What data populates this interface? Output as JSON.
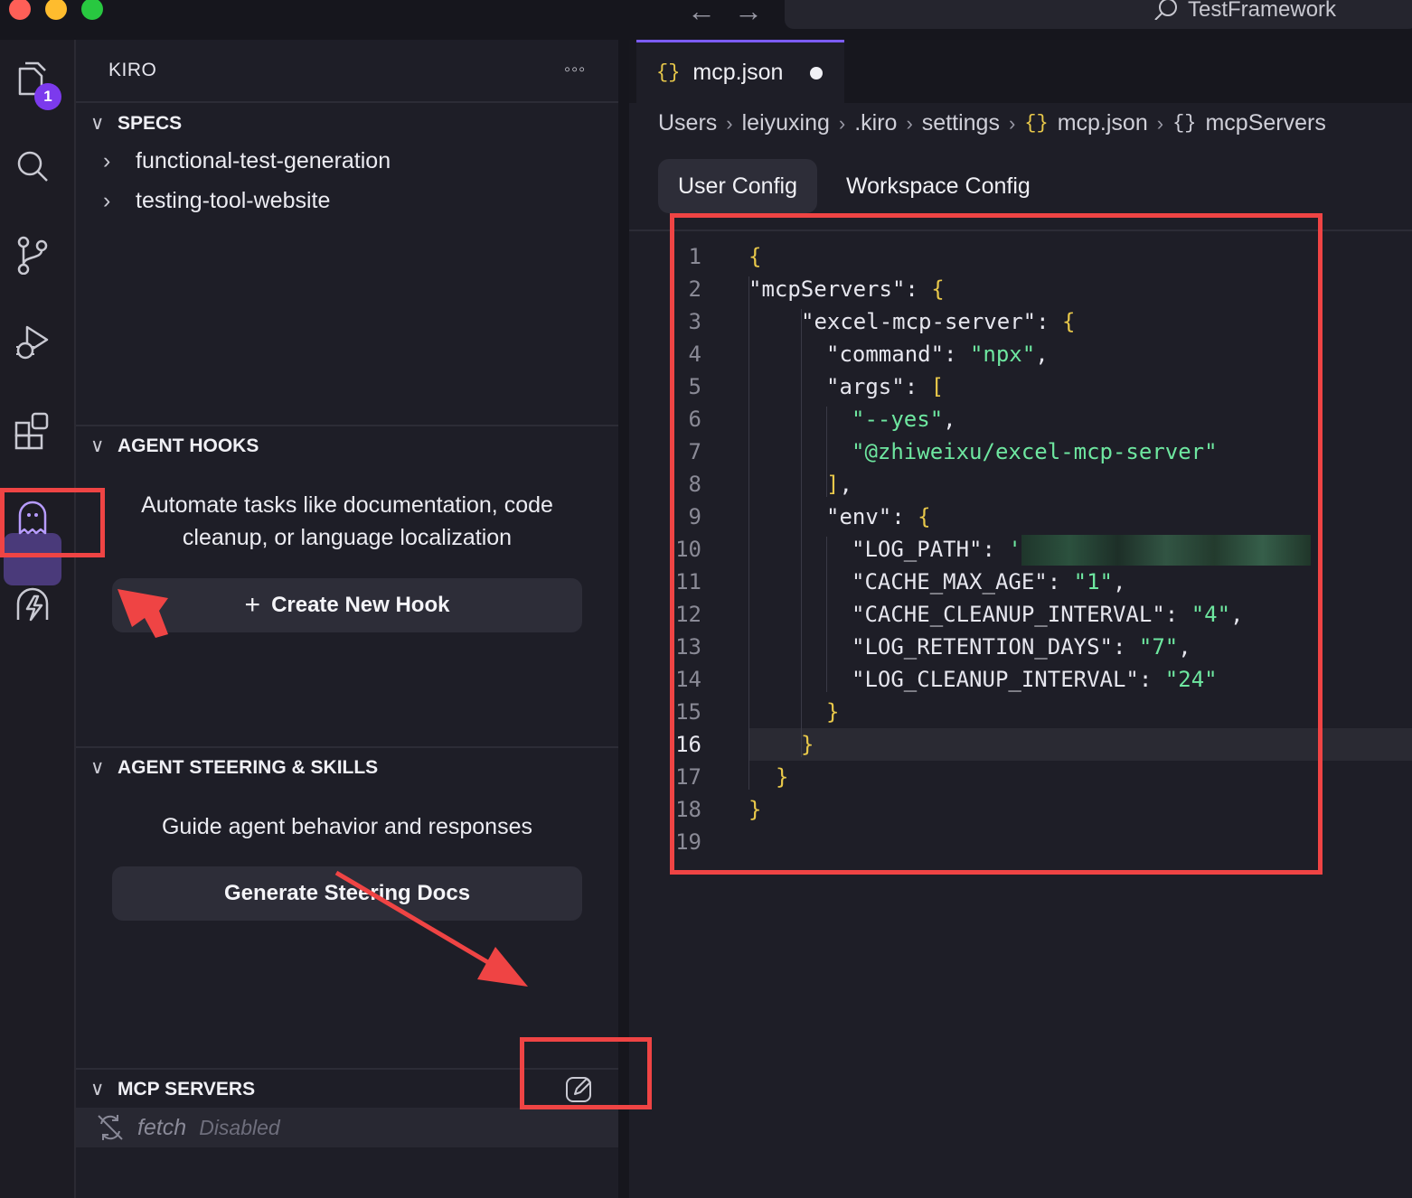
{
  "window": {
    "title": "TestFramework"
  },
  "activity_bar": {
    "explorer_badge": "1"
  },
  "sidebar": {
    "header": "KIRO",
    "more": "◦◦◦",
    "specs": {
      "title": "SPECS",
      "items": [
        "functional-test-generation",
        "testing-tool-website"
      ]
    },
    "hooks": {
      "title": "AGENT HOOKS",
      "description": "Automate tasks like documentation, code cleanup, or language localization",
      "button": "Create New Hook"
    },
    "steering": {
      "title": "AGENT STEERING & SKILLS",
      "description": "Guide agent behavior and responses",
      "button": "Generate Steering Docs"
    },
    "mcp": {
      "title": "MCP SERVERS",
      "servers": [
        {
          "name": "fetch",
          "status": "Disabled"
        }
      ]
    }
  },
  "editor": {
    "tab": {
      "name": "mcp.json",
      "icon": "{}"
    },
    "breadcrumb": [
      "Users",
      "leiyuxing",
      ".kiro",
      "settings",
      "mcp.json",
      "mcpServers"
    ],
    "config_tabs": [
      "User Config",
      "Workspace Config"
    ],
    "current_line": 16,
    "lines": [
      "{",
      "\"mcpServers\": {",
      "\"excel-mcp-server\": {",
      "\"command\": \"npx\",",
      "\"args\": [",
      "\"--yes\",",
      "\"@zhiweixu/excel-mcp-server\"",
      "],",
      "\"env\": {",
      "\"LOG_PATH\": '",
      "\"CACHE_MAX_AGE\": \"1\",",
      "\"CACHE_CLEANUP_INTERVAL\": \"4\",",
      "\"LOG_RETENTION_DAYS\": \"7\",",
      "\"LOG_CLEANUP_INTERVAL\": \"24\"",
      "}",
      "}",
      "}",
      "}",
      ""
    ]
  },
  "colors": {
    "accent": "#7c3aed",
    "annotation": "#ef4444",
    "string": "#6ee7a0",
    "bracket": "#e8c84a"
  }
}
